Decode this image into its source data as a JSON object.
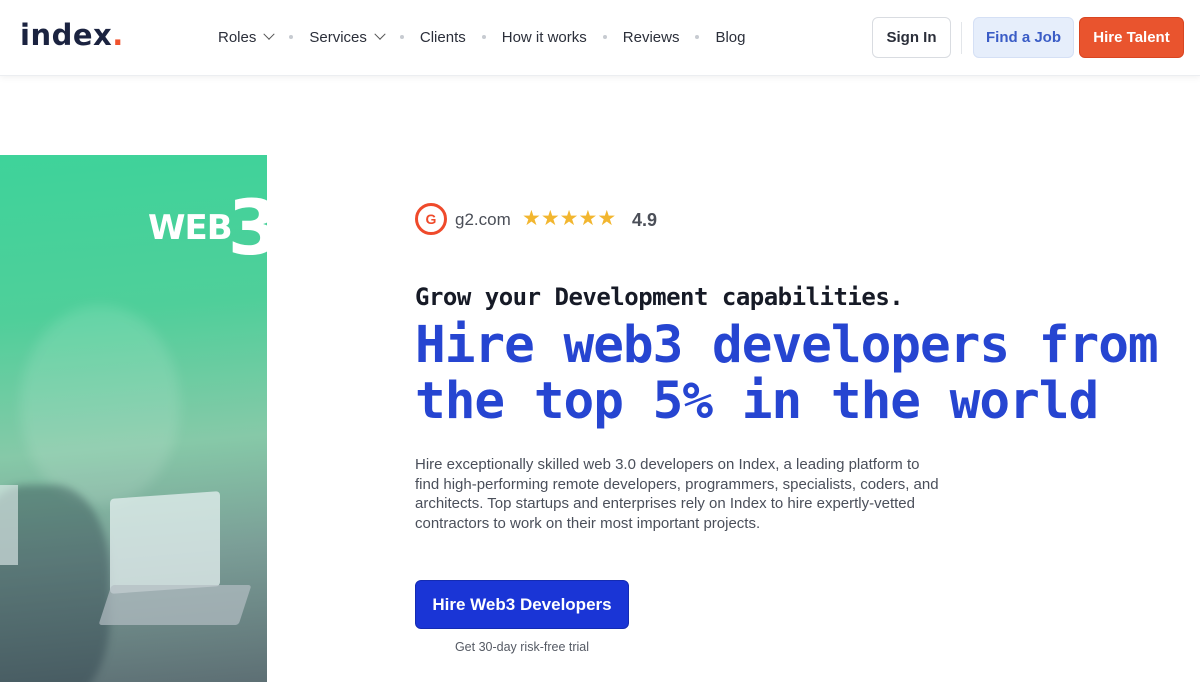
{
  "header": {
    "logo": "index",
    "logo_dot": ".",
    "nav": [
      {
        "label": "Roles",
        "dropdown": true
      },
      {
        "label": "Services",
        "dropdown": true
      },
      {
        "label": "Clients",
        "dropdown": false
      },
      {
        "label": "How it works",
        "dropdown": false
      },
      {
        "label": "Reviews",
        "dropdown": false
      },
      {
        "label": "Blog",
        "dropdown": false
      }
    ],
    "sign_in": "Sign In",
    "find_job": "Find a Job",
    "hire_talent": "Hire Talent"
  },
  "hero": {
    "badge_text": "WEB",
    "badge_num": "3",
    "review_site": "g2.com",
    "review_icon_text": "G",
    "rating_value": "4.9",
    "stars": 5,
    "kicker": "Grow your Development capabilities.",
    "headline": "Hire web3 developers from the top 5% in the world",
    "description": "Hire exceptionally skilled web 3.0 developers on Index, a leading platform to find high-performing remote developers, programmers, specialists, coders, and architects. Top startups and enterprises rely on Index to hire expertly-vetted contractors to work on their most important projects.",
    "cta": "Hire Web3 Developers",
    "trial_note": "Get 30-day risk-free trial"
  },
  "colors": {
    "brand_orange": "#e9542e",
    "headline_blue": "#2645d1",
    "cta_blue": "#1a35d6",
    "star_gold": "#f2b62f",
    "panel_green": "#3ed39a"
  }
}
